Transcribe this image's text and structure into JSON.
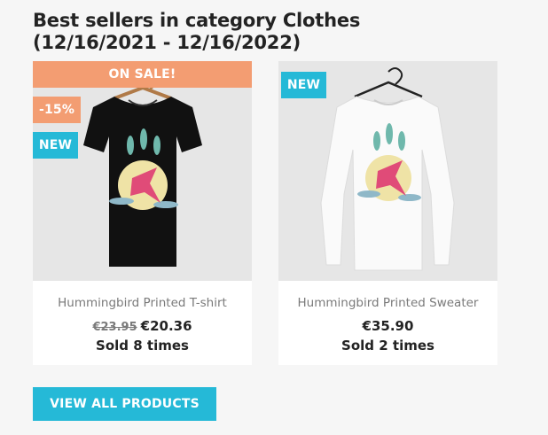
{
  "heading": {
    "line1": "Best sellers in category Clothes",
    "line2": "(12/16/2021 - 12/16/2022)"
  },
  "products": [
    {
      "badge_sale": "ON SALE!",
      "badge_discount": "-15%",
      "badge_new": "NEW",
      "name": "Hummingbird Printed T-shirt",
      "regular_price": "€23.95",
      "price": "€20.36",
      "sold": "Sold 8 times",
      "shirt_color": "#111111"
    },
    {
      "badge_new": "NEW",
      "name": "Hummingbird Printed Sweater",
      "price": "€35.90",
      "sold": "Sold 2 times",
      "shirt_color": "#fafafa"
    }
  ],
  "view_all_label": "VIEW ALL PRODUCTS",
  "colors": {
    "accent_blue": "#25b9d7",
    "sale_orange": "#f39d72"
  }
}
